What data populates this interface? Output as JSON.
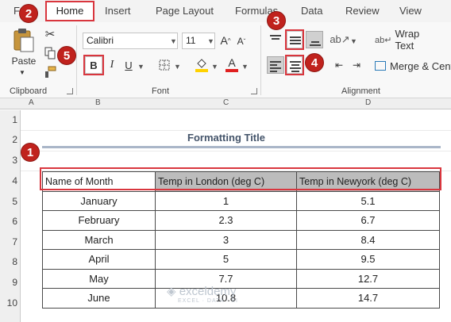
{
  "tabs": [
    "Home",
    "Insert",
    "Page Layout",
    "Formulas",
    "Data",
    "Review",
    "View"
  ],
  "clipboard": {
    "paste_label": "Paste",
    "group_label": "Clipboard"
  },
  "font": {
    "name": "Calibri",
    "size": "11",
    "grow": "A",
    "shrink": "A",
    "bold": "B",
    "italic": "I",
    "underline": "U",
    "font_color": "A",
    "group_label": "Font"
  },
  "alignment": {
    "wrap_text": "Wrap Text",
    "merge_center": "Merge & Cente",
    "group_label": "Alignment"
  },
  "badges": [
    "1",
    "2",
    "3",
    "4",
    "5"
  ],
  "sheet": {
    "columns": [
      "A",
      "B",
      "C",
      "D"
    ],
    "rows": [
      "1",
      "2",
      "3",
      "4",
      "5",
      "6",
      "7",
      "8",
      "9",
      "10"
    ],
    "title": "Formatting Title",
    "headers": [
      "Name of Month",
      "Temp in London (deg C)",
      "Temp in Newyork (deg C)"
    ],
    "data": [
      [
        "January",
        "1",
        "5.1"
      ],
      [
        "February",
        "2.3",
        "6.7"
      ],
      [
        "March",
        "3",
        "8.4"
      ],
      [
        "April",
        "5",
        "9.5"
      ],
      [
        "May",
        "7.7",
        "12.7"
      ],
      [
        "June",
        "10.8",
        "14.7"
      ]
    ]
  },
  "watermark": {
    "brand": "exceldemy",
    "tagline": "EXCEL · DATA · BI"
  },
  "colors": {
    "accent_red": "#d9363e",
    "badge": "#c0221d",
    "header_fill": "#bcbcbc",
    "title": "#44546a",
    "font_color_bar": "#e02020",
    "fill_bar": "#ffd200"
  }
}
